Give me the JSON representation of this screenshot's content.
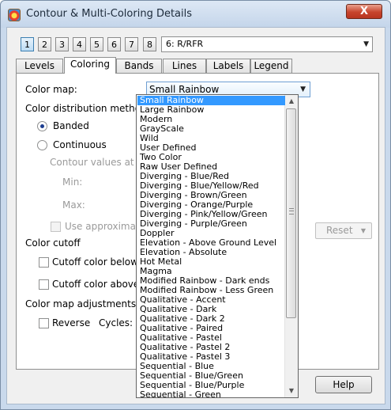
{
  "window": {
    "title": "Contour & Multi-Coloring Details",
    "close_glyph": "X"
  },
  "plot_buttons": [
    "1",
    "2",
    "3",
    "4",
    "5",
    "6",
    "7",
    "8"
  ],
  "plot_select": {
    "value": "6: R/RFR"
  },
  "tabs": [
    "Levels",
    "Coloring",
    "Bands",
    "Lines",
    "Labels",
    "Legend"
  ],
  "active_tab": "Coloring",
  "coloring": {
    "color_map_label": "Color map:",
    "color_map_value": "Small Rainbow",
    "distribution_label": "Color distribution method",
    "banded_label": "Banded",
    "continuous_label": "Continuous",
    "contour_values_label": "Contour values at co",
    "min_label": "Min:",
    "max_label": "Max:",
    "use_approximate_label": "Use approximate c",
    "reset_label": "Reset",
    "cutoff_label": "Color cutoff",
    "cutoff_below_label": "Cutoff color below:",
    "cutoff_above_label": "Cutoff color above:",
    "adjustments_label": "Color map adjustments",
    "reverse_label": "Reverse",
    "cycles_label": "Cycles:"
  },
  "dropdown": {
    "options": [
      "Small Rainbow",
      "Large Rainbow",
      "Modern",
      "GrayScale",
      "Wild",
      "User Defined",
      "Two Color",
      "Raw User Defined",
      "Diverging - Blue/Red",
      "Diverging - Blue/Yellow/Red",
      "Diverging - Brown/Green",
      "Diverging - Orange/Purple",
      "Diverging - Pink/Yellow/Green",
      "Diverging - Purple/Green",
      "Doppler",
      "Elevation - Above Ground Level",
      "Elevation - Absolute",
      "Hot Metal",
      "Magma",
      "Modified Rainbow - Dark ends",
      "Modified Rainbow - Less Green",
      "Qualitative - Accent",
      "Qualitative - Dark",
      "Qualitative - Dark 2",
      "Qualitative - Paired",
      "Qualitative - Pastel",
      "Qualitative - Pastel 2",
      "Qualitative - Pastel 3",
      "Sequential - Blue",
      "Sequential - Blue/Green",
      "Sequential - Blue/Purple",
      "Sequential - Green"
    ],
    "selected": "Small Rainbow"
  },
  "buttons": {
    "help": "Help"
  },
  "icons": {
    "app": "contour-app-icon",
    "dropdown_arrow": "▼",
    "scroll_up": "▲",
    "scroll_down": "▼"
  }
}
